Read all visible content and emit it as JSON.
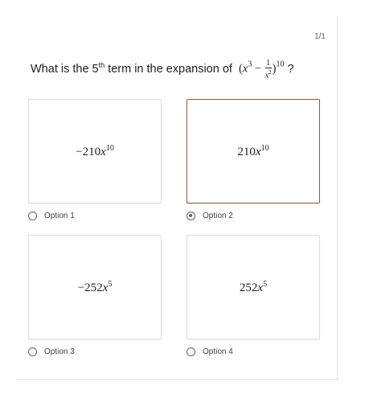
{
  "counter": "1/1",
  "question": {
    "prefix": "What is the 5",
    "ordinal": "th",
    "suffix": " term in the expansion of",
    "math_open": "(",
    "math_var": "x",
    "math_var_exp": "3",
    "math_minus": " − ",
    "frac_num": "1",
    "frac_den_var": "x",
    "frac_den_exp": "2",
    "math_close": ")",
    "math_outer_exp": "10",
    "qmark": "?"
  },
  "options": [
    {
      "coef": "−210",
      "var": "x",
      "exp": "10",
      "label": "Option 1",
      "selected": false
    },
    {
      "coef": "210",
      "var": "x",
      "exp": "10",
      "label": "Option 2",
      "selected": true
    },
    {
      "coef": "−252",
      "var": "x",
      "exp": "5",
      "label": "Option 3",
      "selected": false
    },
    {
      "coef": "252",
      "var": "x",
      "exp": "5",
      "label": "Option 4",
      "selected": false
    }
  ],
  "colors": {
    "selected_border": "#8b5a3c",
    "box_border": "#dadce0",
    "radio": "#5f6368"
  }
}
